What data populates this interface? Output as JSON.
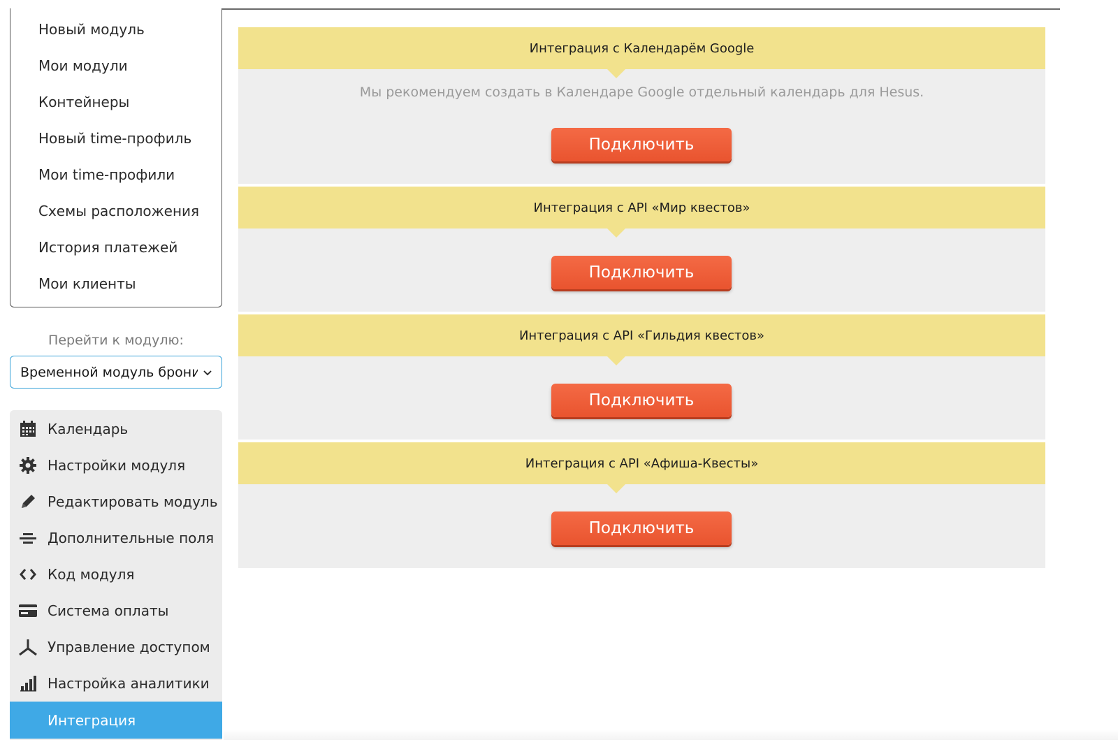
{
  "menu": {
    "items": [
      "Новый модуль",
      "Мои модули",
      "Контейнеры",
      "Новый time-профиль",
      "Мои time-профили",
      "Схемы расположения",
      "История платежей",
      "Мои клиенты"
    ]
  },
  "module_switch": {
    "label": "Перейти к модулю:",
    "selected": "Временной модуль брони"
  },
  "module_nav": {
    "items": [
      {
        "label": "Календарь",
        "icon": "calendar-icon"
      },
      {
        "label": "Настройки модуля",
        "icon": "gear-icon"
      },
      {
        "label": "Редактировать модуль",
        "icon": "pencil-icon"
      },
      {
        "label": "Дополнительные поля",
        "icon": "fields-icon"
      },
      {
        "label": "Код модуля",
        "icon": "code-icon"
      },
      {
        "label": "Система оплаты",
        "icon": "credit-card-icon"
      },
      {
        "label": "Управление доступом",
        "icon": "access-icon"
      },
      {
        "label": "Настройка аналитики",
        "icon": "analytics-icon"
      },
      {
        "label": "Интеграция",
        "icon": "integration-icon",
        "active": true
      }
    ]
  },
  "integrations": [
    {
      "title": "Интеграция с Календарём Google",
      "description": "Мы рекомендуем создать в Календаре Google отдельный календарь для Hesus.",
      "button": "Подключить"
    },
    {
      "title": "Интеграция с API «Мир квестов»",
      "button": "Подключить"
    },
    {
      "title": "Интеграция с API «Гильдия квестов»",
      "button": "Подключить"
    },
    {
      "title": "Интеграция с API «Афиша-Квесты»",
      "button": "Подключить"
    }
  ],
  "colors": {
    "panel_header": "#f2e28d",
    "panel_body": "#eeeeee",
    "button": "#ee5a35",
    "active_nav": "#3fa9e6"
  }
}
